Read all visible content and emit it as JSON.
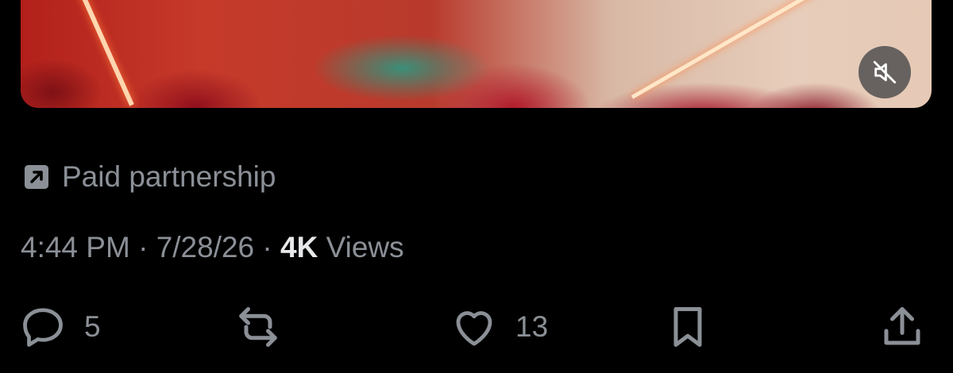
{
  "media": {
    "mute_icon": "volume-muted-icon"
  },
  "sponsor": {
    "icon": "paid-partnership-arrow-icon",
    "label": "Paid partnership"
  },
  "meta": {
    "time": "4:44 PM",
    "separator": "·",
    "date": "7/28/26",
    "views_count": "4K",
    "views_label": "Views"
  },
  "actions": {
    "reply_count": "5",
    "repost_count": "",
    "like_count": "13"
  },
  "colors": {
    "background": "#000000",
    "secondary_text": "#8b9097",
    "primary_text": "#e7e9ea"
  }
}
